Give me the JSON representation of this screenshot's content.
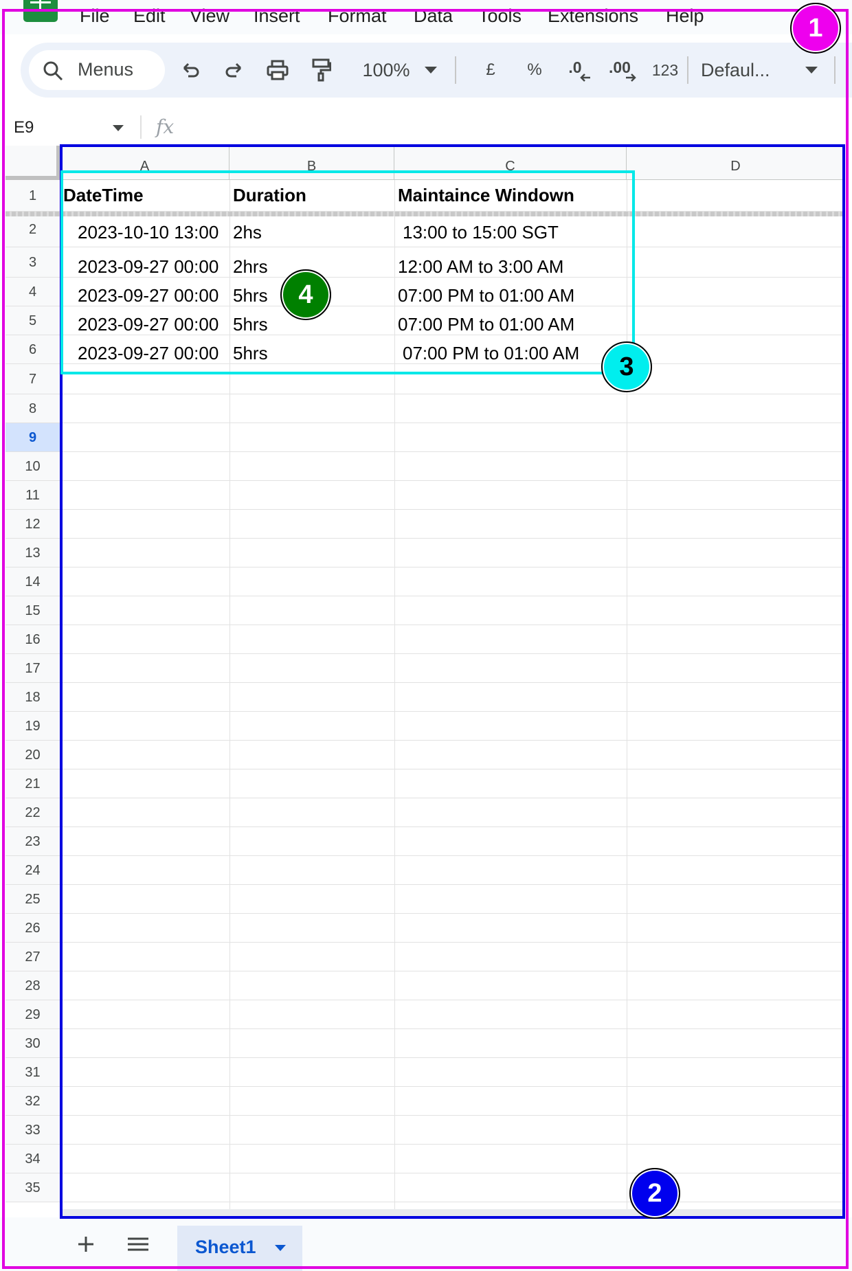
{
  "menu": [
    "File",
    "Edit",
    "View",
    "Insert",
    "Format",
    "Data",
    "Tools",
    "Extensions",
    "Help"
  ],
  "toolbar": {
    "search_label": "Menus",
    "zoom": "100%",
    "currency": "£",
    "percent": "%",
    "decrease_decimal": ".0",
    "increase_decimal": ".00",
    "number_format": "123",
    "font": "Defaul..."
  },
  "formula_bar": {
    "name_box": "E9",
    "fx": "fx"
  },
  "grid": {
    "columns": [
      "A",
      "B",
      "C",
      "D"
    ],
    "rows": [
      "1",
      "2",
      "3",
      "4",
      "5",
      "6",
      "7",
      "8",
      "9",
      "10",
      "11",
      "12",
      "13",
      "14",
      "15",
      "16",
      "17",
      "18",
      "19",
      "20",
      "21",
      "22",
      "23",
      "24",
      "25",
      "26",
      "27",
      "28",
      "29",
      "30",
      "31",
      "32",
      "33",
      "34",
      "35"
    ],
    "selected_row": "9",
    "headers": [
      "DateTime",
      "Duration",
      "Maintaince Windown"
    ],
    "data": [
      [
        "2023-10-10 13:00",
        "2hs",
        "13:00 to 15:00 SGT"
      ],
      [
        "2023-09-27 00:00",
        "2hrs",
        "12:00 AM to 3:00 AM"
      ],
      [
        "2023-09-27 00:00",
        "5hrs",
        "07:00 PM to 01:00 AM"
      ],
      [
        "2023-09-27 00:00",
        "5hrs",
        "07:00 PM to 01:00 AM"
      ],
      [
        "2023-09-27 00:00",
        "5hrs",
        "07:00 PM to 01:00 AM"
      ]
    ]
  },
  "sheet_tabs": {
    "active": "Sheet1"
  },
  "annotations": [
    "1",
    "2",
    "3",
    "4"
  ],
  "colors": {
    "annotation_1": "#ee00ee",
    "annotation_2": "#0000ee",
    "annotation_3": "#00eeee",
    "annotation_4": "#008000",
    "selected_accent": "#0b57d0"
  }
}
